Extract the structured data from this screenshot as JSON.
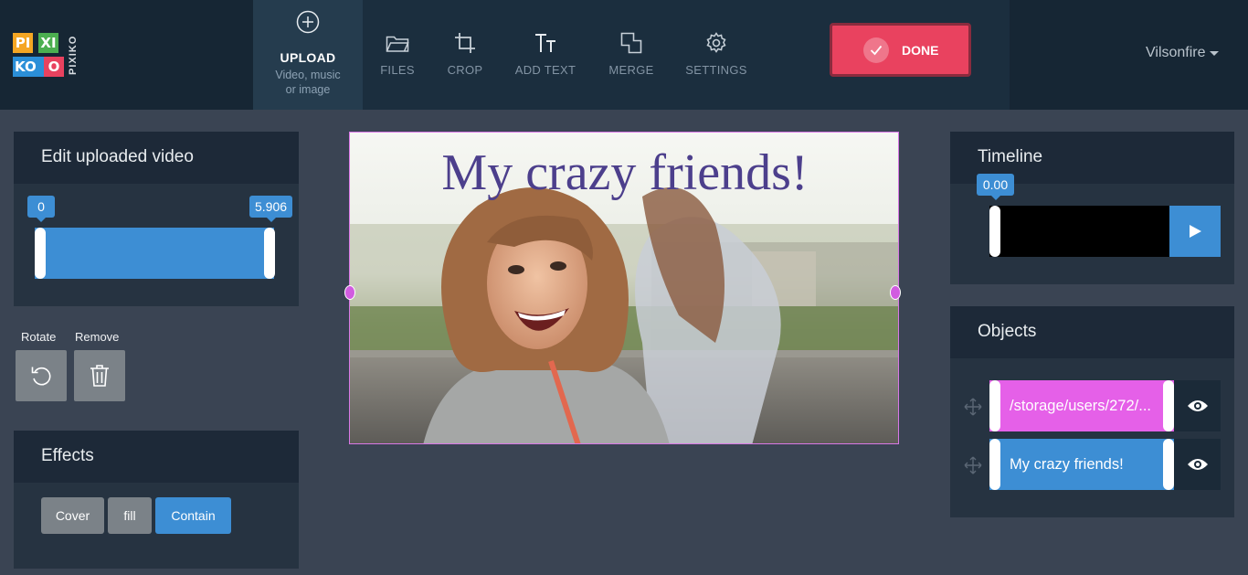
{
  "app": {
    "logo_letters": [
      "PI",
      "XI",
      "KO",
      "O"
    ],
    "logo_side_text": "PIXIKO",
    "accent": "#3d8ed4",
    "done_color": "#e9425f",
    "object_pink": "#e560e8"
  },
  "toolbar": {
    "upload": {
      "label": "UPLOAD",
      "sub": "Video, music or image",
      "icon": "plus-circle-icon"
    },
    "files": {
      "label": "FILES",
      "icon": "folder-icon"
    },
    "crop": {
      "label": "CROP",
      "icon": "crop-icon"
    },
    "add_text": {
      "label": "ADD TEXT",
      "icon": "text-icon"
    },
    "merge": {
      "label": "MERGE",
      "icon": "merge-icon"
    },
    "settings": {
      "label": "SETTINGS",
      "icon": "gear-icon"
    },
    "done": {
      "label": "DONE",
      "icon": "check-icon"
    }
  },
  "user": {
    "name": "Vilsonfire"
  },
  "edit_video": {
    "title": "Edit uploaded video",
    "range_start": "0",
    "range_end": "5.906"
  },
  "actions": {
    "rotate_label": "Rotate",
    "remove_label": "Remove"
  },
  "effects": {
    "title": "Effects",
    "options": [
      "Cover",
      "fill",
      "Contain"
    ],
    "selected": "Contain"
  },
  "canvas": {
    "caption": "My crazy friends!"
  },
  "timeline": {
    "title": "Timeline",
    "position": "0.00"
  },
  "objects": {
    "title": "Objects",
    "items": [
      {
        "label": "/storage/users/272/...",
        "color": "#e560e8"
      },
      {
        "label": "My crazy friends!",
        "color": "#3d8ed4"
      }
    ]
  }
}
